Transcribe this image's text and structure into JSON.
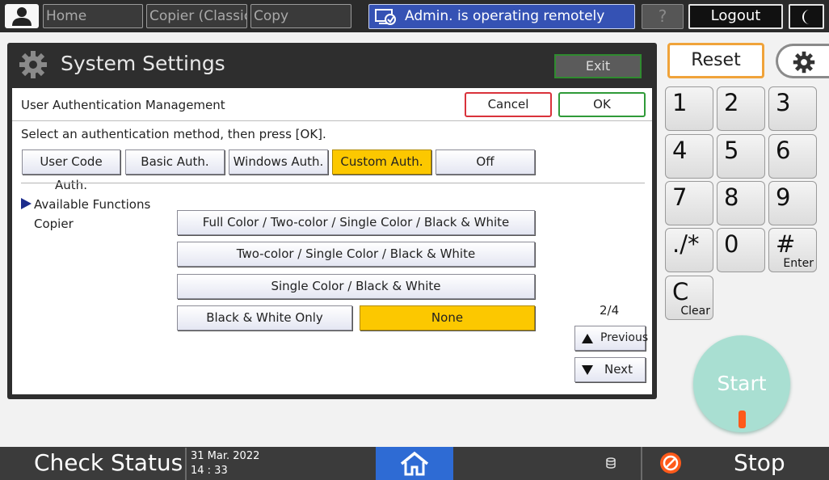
{
  "topbar": {
    "home": "Home",
    "copier_classic": "Copier (Classic)",
    "copy": "Copy",
    "remote_banner": "Admin. is operating remotely",
    "help": "?",
    "logout": "Logout"
  },
  "panel": {
    "title": "System Settings",
    "exit": "Exit"
  },
  "dialog": {
    "title": "User Authentication Management",
    "cancel": "Cancel",
    "ok": "OK",
    "instruction": "Select an authentication method, then press [OK].",
    "auth_methods": [
      {
        "label": "User Code Auth.",
        "selected": false
      },
      {
        "label": "Basic Auth.",
        "selected": false
      },
      {
        "label": "Windows Auth.",
        "selected": false
      },
      {
        "label": "Custom Auth.",
        "selected": true
      },
      {
        "label": "Off",
        "selected": false
      }
    ],
    "available_functions": "Available Functions",
    "copier": "Copier",
    "color_options": [
      {
        "label": "Full Color / Two-color / Single Color / Black & White",
        "selected": false
      },
      {
        "label": "Two-color / Single Color / Black & White",
        "selected": false
      },
      {
        "label": "Single Color / Black & White",
        "selected": false
      },
      {
        "label": "Black & White Only",
        "selected": false
      },
      {
        "label": "None",
        "selected": true
      }
    ],
    "page": "2/4",
    "previous": "Previous",
    "next": "Next"
  },
  "keypad": {
    "reset": "Reset",
    "keys": [
      {
        "main": "1",
        "sub": ""
      },
      {
        "main": "2",
        "sub": ""
      },
      {
        "main": "3",
        "sub": ""
      },
      {
        "main": "4",
        "sub": ""
      },
      {
        "main": "5",
        "sub": ""
      },
      {
        "main": "6",
        "sub": ""
      },
      {
        "main": "7",
        "sub": ""
      },
      {
        "main": "8",
        "sub": ""
      },
      {
        "main": "9",
        "sub": ""
      },
      {
        "main": "./*",
        "sub": ""
      },
      {
        "main": "0",
        "sub": ""
      },
      {
        "main": "#",
        "sub": "Enter"
      },
      {
        "main": "C",
        "sub": "Clear"
      }
    ],
    "start": "Start"
  },
  "bottombar": {
    "check_status": "Check Status",
    "date": "31 Mar. 2022",
    "time": "14 : 33",
    "stop": "Stop"
  },
  "colors": {
    "selected": "#fcc800",
    "remote_banner": "#3552b4",
    "home_button": "#2e6bd4",
    "start_button": "#a9dfd2",
    "reset_border": "#f0a33a"
  },
  "icons": [
    "user-icon",
    "remote-operation-icon",
    "help-icon",
    "night-mode-icon",
    "gear-icon",
    "home-icon",
    "data-icon",
    "stop-icon"
  ]
}
